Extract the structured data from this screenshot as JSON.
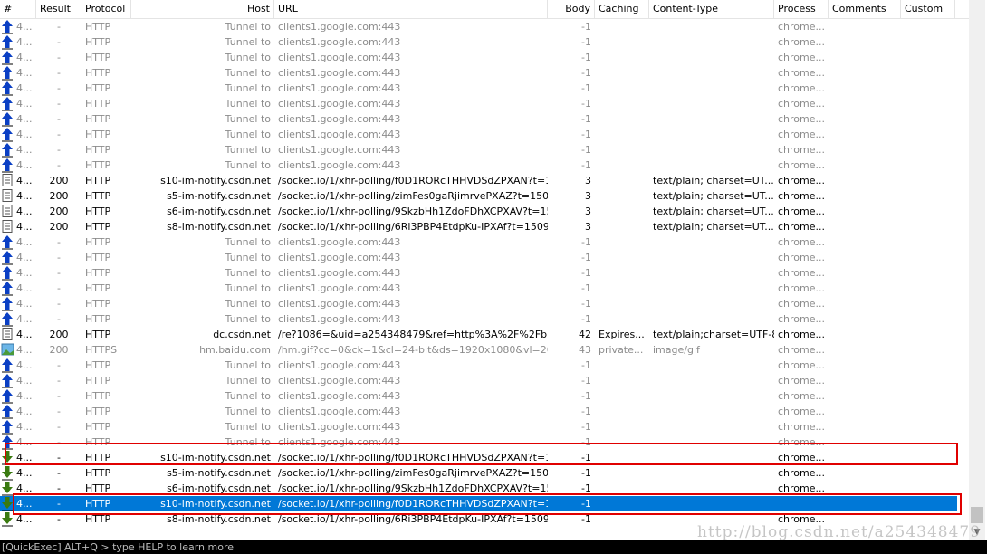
{
  "columns": [
    "#",
    "Result",
    "Protocol",
    "Host",
    "URL",
    "Body",
    "Caching",
    "Content-Type",
    "Process",
    "Comments",
    "Custom"
  ],
  "colors": {
    "selection": "#0078d7",
    "highlight_box": "#e00000",
    "upload_arrow": "#0a3fc4",
    "download_arrow": "#3a7a10"
  },
  "rows": [
    {
      "icon": "upload-arrow-icon",
      "id": "4...",
      "result": "-",
      "protocol": "HTTP",
      "host": "Tunnel to",
      "url": "clients1.google.com:443",
      "body": "-1",
      "caching": "",
      "ctype": "",
      "process": "chrome...",
      "style": "gray"
    },
    {
      "icon": "upload-arrow-icon",
      "id": "4...",
      "result": "-",
      "protocol": "HTTP",
      "host": "Tunnel to",
      "url": "clients1.google.com:443",
      "body": "-1",
      "caching": "",
      "ctype": "",
      "process": "chrome...",
      "style": "gray"
    },
    {
      "icon": "upload-arrow-icon",
      "id": "4...",
      "result": "-",
      "protocol": "HTTP",
      "host": "Tunnel to",
      "url": "clients1.google.com:443",
      "body": "-1",
      "caching": "",
      "ctype": "",
      "process": "chrome...",
      "style": "gray"
    },
    {
      "icon": "upload-arrow-icon",
      "id": "4...",
      "result": "-",
      "protocol": "HTTP",
      "host": "Tunnel to",
      "url": "clients1.google.com:443",
      "body": "-1",
      "caching": "",
      "ctype": "",
      "process": "chrome...",
      "style": "gray"
    },
    {
      "icon": "upload-arrow-icon",
      "id": "4...",
      "result": "-",
      "protocol": "HTTP",
      "host": "Tunnel to",
      "url": "clients1.google.com:443",
      "body": "-1",
      "caching": "",
      "ctype": "",
      "process": "chrome...",
      "style": "gray"
    },
    {
      "icon": "upload-arrow-icon",
      "id": "4...",
      "result": "-",
      "protocol": "HTTP",
      "host": "Tunnel to",
      "url": "clients1.google.com:443",
      "body": "-1",
      "caching": "",
      "ctype": "",
      "process": "chrome...",
      "style": "gray"
    },
    {
      "icon": "upload-arrow-icon",
      "id": "4...",
      "result": "-",
      "protocol": "HTTP",
      "host": "Tunnel to",
      "url": "clients1.google.com:443",
      "body": "-1",
      "caching": "",
      "ctype": "",
      "process": "chrome...",
      "style": "gray"
    },
    {
      "icon": "upload-arrow-icon",
      "id": "4...",
      "result": "-",
      "protocol": "HTTP",
      "host": "Tunnel to",
      "url": "clients1.google.com:443",
      "body": "-1",
      "caching": "",
      "ctype": "",
      "process": "chrome...",
      "style": "gray"
    },
    {
      "icon": "upload-arrow-icon",
      "id": "4...",
      "result": "-",
      "protocol": "HTTP",
      "host": "Tunnel to",
      "url": "clients1.google.com:443",
      "body": "-1",
      "caching": "",
      "ctype": "",
      "process": "chrome...",
      "style": "gray"
    },
    {
      "icon": "upload-arrow-icon",
      "id": "4...",
      "result": "-",
      "protocol": "HTTP",
      "host": "Tunnel to",
      "url": "clients1.google.com:443",
      "body": "-1",
      "caching": "",
      "ctype": "",
      "process": "chrome...",
      "style": "gray"
    },
    {
      "icon": "document-icon",
      "id": "4...",
      "result": "200",
      "protocol": "HTTP",
      "host": "s10-im-notify.csdn.net",
      "url": "/socket.io/1/xhr-polling/f0D1RORcTHHVDSdZPXAN?t=150...",
      "body": "3",
      "caching": "",
      "ctype": "text/plain; charset=UT...",
      "process": "chrome...",
      "style": "black"
    },
    {
      "icon": "document-icon",
      "id": "4...",
      "result": "200",
      "protocol": "HTTP",
      "host": "s5-im-notify.csdn.net",
      "url": "/socket.io/1/xhr-polling/zimFes0gaRjimrvePXAZ?t=15096...",
      "body": "3",
      "caching": "",
      "ctype": "text/plain; charset=UT...",
      "process": "chrome...",
      "style": "black"
    },
    {
      "icon": "document-icon",
      "id": "4...",
      "result": "200",
      "protocol": "HTTP",
      "host": "s6-im-notify.csdn.net",
      "url": "/socket.io/1/xhr-polling/9SkzbHh1ZdoFDhXCPXAV?t=150...",
      "body": "3",
      "caching": "",
      "ctype": "text/plain; charset=UT...",
      "process": "chrome...",
      "style": "black"
    },
    {
      "icon": "document-icon",
      "id": "4...",
      "result": "200",
      "protocol": "HTTP",
      "host": "s8-im-notify.csdn.net",
      "url": "/socket.io/1/xhr-polling/6Ri3PBP4EtdpKu-IPXAf?t=15096...",
      "body": "3",
      "caching": "",
      "ctype": "text/plain; charset=UT...",
      "process": "chrome...",
      "style": "black"
    },
    {
      "icon": "upload-arrow-icon",
      "id": "4...",
      "result": "-",
      "protocol": "HTTP",
      "host": "Tunnel to",
      "url": "clients1.google.com:443",
      "body": "-1",
      "caching": "",
      "ctype": "",
      "process": "chrome...",
      "style": "gray"
    },
    {
      "icon": "upload-arrow-icon",
      "id": "4...",
      "result": "-",
      "protocol": "HTTP",
      "host": "Tunnel to",
      "url": "clients1.google.com:443",
      "body": "-1",
      "caching": "",
      "ctype": "",
      "process": "chrome...",
      "style": "gray"
    },
    {
      "icon": "upload-arrow-icon",
      "id": "4...",
      "result": "-",
      "protocol": "HTTP",
      "host": "Tunnel to",
      "url": "clients1.google.com:443",
      "body": "-1",
      "caching": "",
      "ctype": "",
      "process": "chrome...",
      "style": "gray"
    },
    {
      "icon": "upload-arrow-icon",
      "id": "4...",
      "result": "-",
      "protocol": "HTTP",
      "host": "Tunnel to",
      "url": "clients1.google.com:443",
      "body": "-1",
      "caching": "",
      "ctype": "",
      "process": "chrome...",
      "style": "gray"
    },
    {
      "icon": "upload-arrow-icon",
      "id": "4...",
      "result": "-",
      "protocol": "HTTP",
      "host": "Tunnel to",
      "url": "clients1.google.com:443",
      "body": "-1",
      "caching": "",
      "ctype": "",
      "process": "chrome...",
      "style": "gray"
    },
    {
      "icon": "upload-arrow-icon",
      "id": "4...",
      "result": "-",
      "protocol": "HTTP",
      "host": "Tunnel to",
      "url": "clients1.google.com:443",
      "body": "-1",
      "caching": "",
      "ctype": "",
      "process": "chrome...",
      "style": "gray"
    },
    {
      "icon": "document-icon",
      "id": "4...",
      "result": "200",
      "protocol": "HTTP",
      "host": "dc.csdn.net",
      "url": "/re?1086=&uid=a254348479&ref=http%3A%2F%2Fblo...",
      "body": "42",
      "caching": "Expires...",
      "ctype": "text/plain;charset=UTF-8",
      "process": "chrome...",
      "style": "black"
    },
    {
      "icon": "image-icon",
      "id": "4...",
      "result": "200",
      "protocol": "HTTPS",
      "host": "hm.baidu.com",
      "url": "/hm.gif?cc=0&ck=1&cl=24-bit&ds=1920x1080&vl=2006...",
      "body": "43",
      "caching": "private...",
      "ctype": "image/gif",
      "process": "chrome...",
      "style": "gray"
    },
    {
      "icon": "upload-arrow-icon",
      "id": "4...",
      "result": "-",
      "protocol": "HTTP",
      "host": "Tunnel to",
      "url": "clients1.google.com:443",
      "body": "-1",
      "caching": "",
      "ctype": "",
      "process": "chrome...",
      "style": "gray"
    },
    {
      "icon": "upload-arrow-icon",
      "id": "4...",
      "result": "-",
      "protocol": "HTTP",
      "host": "Tunnel to",
      "url": "clients1.google.com:443",
      "body": "-1",
      "caching": "",
      "ctype": "",
      "process": "chrome...",
      "style": "gray"
    },
    {
      "icon": "upload-arrow-icon",
      "id": "4...",
      "result": "-",
      "protocol": "HTTP",
      "host": "Tunnel to",
      "url": "clients1.google.com:443",
      "body": "-1",
      "caching": "",
      "ctype": "",
      "process": "chrome...",
      "style": "gray"
    },
    {
      "icon": "upload-arrow-icon",
      "id": "4...",
      "result": "-",
      "protocol": "HTTP",
      "host": "Tunnel to",
      "url": "clients1.google.com:443",
      "body": "-1",
      "caching": "",
      "ctype": "",
      "process": "chrome...",
      "style": "gray"
    },
    {
      "icon": "upload-arrow-icon",
      "id": "4...",
      "result": "-",
      "protocol": "HTTP",
      "host": "Tunnel to",
      "url": "clients1.google.com:443",
      "body": "-1",
      "caching": "",
      "ctype": "",
      "process": "chrome...",
      "style": "gray"
    },
    {
      "icon": "upload-arrow-icon",
      "id": "4...",
      "result": "-",
      "protocol": "HTTP",
      "host": "Tunnel to",
      "url": "clients1.google.com:443",
      "body": "-1",
      "caching": "",
      "ctype": "",
      "process": "chrome...",
      "style": "gray"
    },
    {
      "icon": "download-arrow-icon",
      "id": "4...",
      "result": "-",
      "protocol": "HTTP",
      "host": "s10-im-notify.csdn.net",
      "url": "/socket.io/1/xhr-polling/f0D1RORcTHHVDSdZPXAN?t=150...",
      "body": "-1",
      "caching": "",
      "ctype": "",
      "process": "chrome...",
      "style": "black",
      "boxed": true
    },
    {
      "icon": "download-arrow-icon",
      "id": "4...",
      "result": "-",
      "protocol": "HTTP",
      "host": "s5-im-notify.csdn.net",
      "url": "/socket.io/1/xhr-polling/zimFes0gaRjimrvePXAZ?t=15096...",
      "body": "-1",
      "caching": "",
      "ctype": "",
      "process": "chrome...",
      "style": "black"
    },
    {
      "icon": "download-arrow-icon",
      "id": "4...",
      "result": "-",
      "protocol": "HTTP",
      "host": "s6-im-notify.csdn.net",
      "url": "/socket.io/1/xhr-polling/9SkzbHh1ZdoFDhXCPXAV?t=150...",
      "body": "-1",
      "caching": "",
      "ctype": "",
      "process": "chrome...",
      "style": "black"
    },
    {
      "icon": "download-arrow-icon",
      "id": "4...",
      "result": "-",
      "protocol": "HTTP",
      "host": "s10-im-notify.csdn.net",
      "url": "/socket.io/1/xhr-polling/f0D1RORcTHHVDSdZPXAN?t=150...",
      "body": "-1",
      "caching": "",
      "ctype": "",
      "process": "",
      "style": "black",
      "selected": true,
      "boxed": true
    },
    {
      "icon": "download-arrow-icon",
      "id": "4...",
      "result": "-",
      "protocol": "HTTP",
      "host": "s8-im-notify.csdn.net",
      "url": "/socket.io/1/xhr-polling/6Ri3PBP4EtdpKu-IPXAf?t=15096...",
      "body": "-1",
      "caching": "",
      "ctype": "",
      "process": "chrome...",
      "style": "black"
    }
  ],
  "status_bar": "[QuickExec] ALT+Q > type HELP to learn more",
  "watermark": "http://blog.csdn.net/a254348479"
}
